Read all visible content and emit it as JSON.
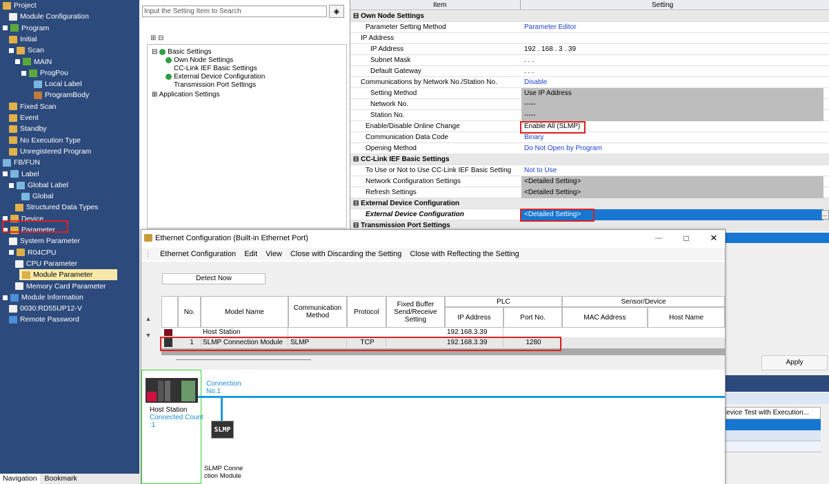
{
  "nav": {
    "items": [
      {
        "label": "Project",
        "indent": 0,
        "icon": "folder-icon"
      },
      {
        "label": "Module Configuration",
        "indent": 1,
        "icon": "module-config-icon"
      },
      {
        "label": "Program",
        "indent": 0,
        "icon": "program-folder-icon",
        "exp": true
      },
      {
        "label": "Initial",
        "indent": 1,
        "icon": "program-icon"
      },
      {
        "label": "Scan",
        "indent": 1,
        "icon": "program-icon",
        "exp": true
      },
      {
        "label": "MAIN",
        "indent": 2,
        "icon": "main-icon",
        "exp": true
      },
      {
        "label": "ProgPou",
        "indent": 3,
        "icon": "pou-icon",
        "exp": true
      },
      {
        "label": "Local Label",
        "indent": 5,
        "icon": "label-icon"
      },
      {
        "label": "ProgramBody",
        "indent": 5,
        "icon": "program-body-icon"
      },
      {
        "label": "Fixed Scan",
        "indent": 1,
        "icon": "program-icon"
      },
      {
        "label": "Event",
        "indent": 1,
        "icon": "program-icon"
      },
      {
        "label": "Standby",
        "indent": 1,
        "icon": "program-icon"
      },
      {
        "label": "No Execution Type",
        "indent": 1,
        "icon": "program-icon"
      },
      {
        "label": "Unregistered Program",
        "indent": 1,
        "icon": "program-icon"
      },
      {
        "label": "FB/FUN",
        "indent": 0,
        "icon": "fb-icon"
      },
      {
        "label": "Label",
        "indent": 0,
        "icon": "label-icon",
        "exp": true
      },
      {
        "label": "Global Label",
        "indent": 1,
        "icon": "label-icon",
        "exp": true
      },
      {
        "label": "Global",
        "indent": 3,
        "icon": "label-icon"
      },
      {
        "label": "Structured Data Types",
        "indent": 2,
        "icon": "struct-icon"
      },
      {
        "label": "Device",
        "indent": 0,
        "icon": "device-icon",
        "exp": true
      },
      {
        "label": "Parameter",
        "indent": 0,
        "icon": "parameter-icon",
        "exp": true
      },
      {
        "label": "System Parameter",
        "indent": 1,
        "icon": "param-icon"
      },
      {
        "label": "R04CPU",
        "indent": 1,
        "icon": "cpu-icon",
        "exp": true
      },
      {
        "label": "CPU Parameter",
        "indent": 2,
        "icon": "param-icon"
      },
      {
        "label": "Module Parameter",
        "indent": 2,
        "icon": "module-param-icon",
        "selected": true
      },
      {
        "label": "Memory Card Parameter",
        "indent": 2,
        "icon": "param-icon"
      },
      {
        "label": "Module Information",
        "indent": 0,
        "icon": "info-icon",
        "exp": true
      },
      {
        "label": "0030:RD55UP12-V",
        "indent": 1,
        "icon": "module-icon"
      },
      {
        "label": "Remote Password",
        "indent": 1,
        "icon": "password-icon"
      }
    ],
    "bottom_tabs": [
      "Navigation",
      "Bookmark"
    ]
  },
  "settings": {
    "search_placeholder": "Input the Setting Item to Search",
    "tree": {
      "root": "Basic Settings",
      "children": [
        "Own Node Settings",
        "CC-Link IEF Basic Settings",
        "External Device Configuration",
        "Transmission Port Settings"
      ],
      "other": "Application Settings"
    }
  },
  "param_table": {
    "col_item": "Item",
    "col_setting": "Setting",
    "rows": [
      {
        "k": "Own Node Settings",
        "v": "",
        "type": "group"
      },
      {
        "k": "Parameter Setting Method",
        "v": "Parameter Editor",
        "indent": 2,
        "blue": true
      },
      {
        "k": "IP Address",
        "v": "",
        "indent": 1
      },
      {
        "k": "IP Address",
        "v": "192 . 168 .   3 . 39",
        "indent": 3
      },
      {
        "k": "Subnet Mask",
        "v": ".     .     .",
        "indent": 3
      },
      {
        "k": "Default Gateway",
        "v": ".     .     .",
        "indent": 3
      },
      {
        "k": "Communications by Network No./Station No.",
        "v": "Disable",
        "indent": 1,
        "blue": true
      },
      {
        "k": "Setting Method",
        "v": "Use IP Address",
        "indent": 3,
        "grey": true
      },
      {
        "k": "Network No.",
        "v": "-----",
        "indent": 3,
        "grey": true
      },
      {
        "k": "Station No.",
        "v": "-----",
        "indent": 3,
        "grey": true
      },
      {
        "k": "Enable/Disable Online Change",
        "v": "Enable All (SLMP)",
        "indent": 2
      },
      {
        "k": "Communication Data Code",
        "v": "Binary",
        "indent": 2,
        "blue": true
      },
      {
        "k": "Opening Method",
        "v": "Do Not Open by Program",
        "indent": 2,
        "blue": true
      },
      {
        "k": "CC-Link IEF Basic Settings",
        "v": "",
        "type": "group"
      },
      {
        "k": "To Use or Not to Use CC-Link IEF Basic Setting",
        "v": "Not to Use",
        "indent": 2,
        "blue": true
      },
      {
        "k": "Network Configuration Settings",
        "v": "<Detailed Setting>",
        "indent": 2,
        "grey": true
      },
      {
        "k": "Refresh Settings",
        "v": "<Detailed Setting>",
        "indent": 2,
        "grey": true
      },
      {
        "k": "External Device Configuration",
        "v": "",
        "type": "group"
      },
      {
        "k": "External Device Configuration",
        "v": "<Detailed Setting>",
        "indent": 2,
        "selected": true
      },
      {
        "k": "Transmission Port Settings",
        "v": "",
        "type": "group"
      }
    ],
    "apply_label": "Apply",
    "side_header": "evice Test with Execution..."
  },
  "dialog": {
    "title": "Ethernet Configuration (Built-in Ethernet Port)",
    "menu": [
      "Ethernet Configuration",
      "Edit",
      "View",
      "Close with Discarding the Setting",
      "Close with Reflecting the Setting"
    ],
    "detect_now": "Detect Now",
    "headers": {
      "no": "No.",
      "model": "Model Name",
      "method": "Communication Method",
      "protocol": "Protocol",
      "fixed": "Fixed Buffer Send/Receive Setting",
      "plc": "PLC",
      "ip": "IP Address",
      "port": "Port No.",
      "sensor": "Sensor/Device",
      "mac": "MAC Address",
      "host": "Host Name"
    },
    "rows": [
      {
        "no": "",
        "model": "Host Station",
        "method": "",
        "protocol": "",
        "fixed": "",
        "ip": "192.168.3.39",
        "port": "",
        "mac": "",
        "host": ""
      },
      {
        "no": "1",
        "model": "SLMP Connection Module",
        "method": "SLMP",
        "protocol": "TCP",
        "fixed": "",
        "ip": "192.168.3.39",
        "port": "1280",
        "mac": "",
        "host": ""
      }
    ],
    "diagram": {
      "connection_label": "Connection\nNo.1",
      "host_label": "Host Station",
      "connected_count": "Connected Count\n:1",
      "slmp_box": "SLMP",
      "slmp_module": "SLMP Conne\nction Module"
    }
  },
  "colors": {
    "nav_bg": "#2d4a7c",
    "highlight": "#e02020",
    "selection": "#1676d2",
    "link": "#1a3fd0"
  }
}
